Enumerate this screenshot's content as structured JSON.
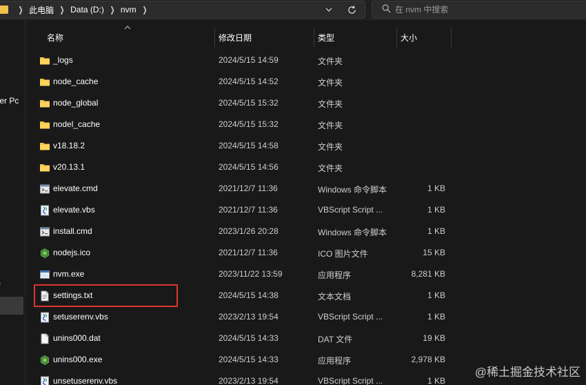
{
  "address_bar": {
    "crumbs": [
      "此电脑",
      "Data (D:)",
      "nvm"
    ]
  },
  "search": {
    "placeholder": "在 nvm 中搜索"
  },
  "nav": {
    "items": [
      "ster Pc",
      ")"
    ]
  },
  "columns": {
    "name": "名称",
    "date": "修改日期",
    "type": "类型",
    "size": "大小"
  },
  "files": [
    {
      "name": "_logs",
      "date": "2024/5/15 14:59",
      "type": "文件夹",
      "size": "",
      "icon": "folder-icon"
    },
    {
      "name": "node_cache",
      "date": "2024/5/15 14:52",
      "type": "文件夹",
      "size": "",
      "icon": "folder-icon"
    },
    {
      "name": "node_global",
      "date": "2024/5/15 15:32",
      "type": "文件夹",
      "size": "",
      "icon": "folder-icon"
    },
    {
      "name": "nodel_cache",
      "date": "2024/5/15 15:32",
      "type": "文件夹",
      "size": "",
      "icon": "folder-icon"
    },
    {
      "name": "v18.18.2",
      "date": "2024/5/15 14:58",
      "type": "文件夹",
      "size": "",
      "icon": "folder-icon"
    },
    {
      "name": "v20.13.1",
      "date": "2024/5/15 14:56",
      "type": "文件夹",
      "size": "",
      "icon": "folder-icon"
    },
    {
      "name": "elevate.cmd",
      "date": "2021/12/7 11:36",
      "type": "Windows 命令脚本",
      "size": "1 KB",
      "icon": "cmd-script-icon"
    },
    {
      "name": "elevate.vbs",
      "date": "2021/12/7 11:36",
      "type": "VBScript Script ...",
      "size": "1 KB",
      "icon": "vbs-script-icon"
    },
    {
      "name": "install.cmd",
      "date": "2023/1/26 20:28",
      "type": "Windows 命令脚本",
      "size": "1 KB",
      "icon": "cmd-script-icon"
    },
    {
      "name": "nodejs.ico",
      "date": "2021/12/7 11:36",
      "type": "ICO 图片文件",
      "size": "15 KB",
      "icon": "nodejs-icon"
    },
    {
      "name": "nvm.exe",
      "date": "2023/11/22 13:59",
      "type": "应用程序",
      "size": "8,281 KB",
      "icon": "exe-window-icon"
    },
    {
      "name": "settings.txt",
      "date": "2024/5/15 14:38",
      "type": "文本文档",
      "size": "1 KB",
      "icon": "text-document-icon"
    },
    {
      "name": "setuserenv.vbs",
      "date": "2023/2/13 19:54",
      "type": "VBScript Script ...",
      "size": "1 KB",
      "icon": "vbs-script-icon"
    },
    {
      "name": "unins000.dat",
      "date": "2024/5/15 14:33",
      "type": "DAT 文件",
      "size": "19 KB",
      "icon": "blank-file-icon"
    },
    {
      "name": "unins000.exe",
      "date": "2024/5/15 14:33",
      "type": "应用程序",
      "size": "2,978 KB",
      "icon": "nodejs-icon"
    },
    {
      "name": "unsetuserenv.vbs",
      "date": "2023/2/13 19:54",
      "type": "VBScript Script ...",
      "size": "1 KB",
      "icon": "vbs-script-icon"
    }
  ],
  "watermark": "@稀土掘金技术社区",
  "colors": {
    "background": "#191919",
    "folder": "#f0c24b",
    "highlight_border": "#e0342f",
    "secondary_text": "#cfcfcf"
  }
}
